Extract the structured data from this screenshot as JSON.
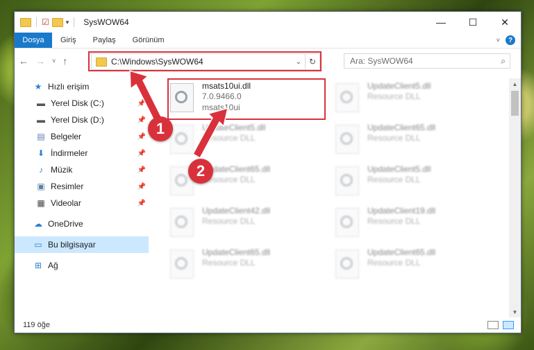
{
  "window": {
    "title": "SysWOW64",
    "buttons": {
      "minimize": "—",
      "maximize": "☐",
      "close": "✕"
    }
  },
  "ribbon": {
    "tabs": [
      "Dosya",
      "Giriş",
      "Paylaş",
      "Görünüm"
    ],
    "help": "?"
  },
  "address": {
    "path": "C:\\Windows\\SysWOW64",
    "search_placeholder": "Ara: SysWOW64"
  },
  "sidebar": {
    "items": [
      {
        "label": "Hızlı erişim",
        "icon": "star-icon",
        "pinned": false
      },
      {
        "label": "Yerel Disk (C:)",
        "icon": "drive-icon",
        "pinned": true
      },
      {
        "label": "Yerel Disk (D:)",
        "icon": "drive-icon",
        "pinned": true
      },
      {
        "label": "Belgeler",
        "icon": "documents-icon",
        "pinned": true
      },
      {
        "label": "İndirmeler",
        "icon": "download-icon",
        "pinned": true
      },
      {
        "label": "Müzik",
        "icon": "music-icon",
        "pinned": true
      },
      {
        "label": "Resimler",
        "icon": "pictures-icon",
        "pinned": true
      },
      {
        "label": "Videolar",
        "icon": "videos-icon",
        "pinned": true
      },
      {
        "label": "OneDrive",
        "icon": "cloud-icon",
        "pinned": false
      },
      {
        "label": "Bu bilgisayar",
        "icon": "computer-icon",
        "pinned": false,
        "selected": true
      },
      {
        "label": "Ağ",
        "icon": "network-icon",
        "pinned": false
      }
    ]
  },
  "files": [
    {
      "name": "msats10ui.dll",
      "line2": "7.0.9466.0",
      "line3": "msats10ui",
      "highlighted": true
    },
    {
      "name": "UpdateClient5.dll",
      "line2": "Resource DLL"
    },
    {
      "name": "UpdateClient5.dll",
      "line2": "Resource DLL"
    },
    {
      "name": "UpdateClient65.dll",
      "line2": "Resource DLL"
    },
    {
      "name": "UpdateClient65.dll",
      "line2": "Resource DLL"
    },
    {
      "name": "UpdateClient5.dll",
      "line2": "Resource DLL"
    },
    {
      "name": "UpdateClient42.dll",
      "line2": "Resource DLL"
    },
    {
      "name": "UpdateClient19.dll",
      "line2": "Resource DLL"
    },
    {
      "name": "UpdateClient65.dll",
      "line2": "Resource DLL"
    },
    {
      "name": "UpdateClient65.dll",
      "line2": "Resource DLL"
    }
  ],
  "status": {
    "count": "119 öğe"
  },
  "annotations": {
    "badge1": "1",
    "badge2": "2",
    "color": "#d9313c"
  }
}
